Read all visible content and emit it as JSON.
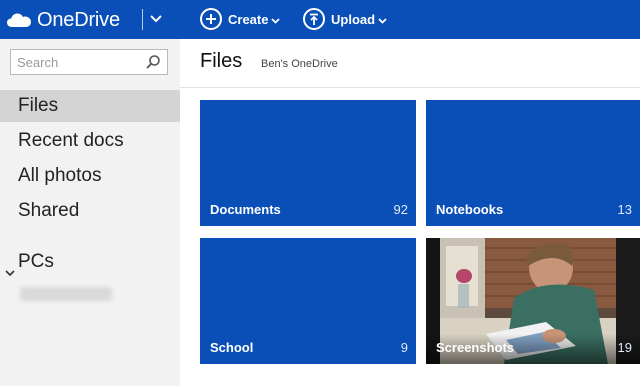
{
  "app": {
    "name": "OneDrive"
  },
  "toolbar": {
    "create_label": "Create",
    "upload_label": "Upload"
  },
  "search": {
    "placeholder": "Search",
    "value": ""
  },
  "sidebar": {
    "items": [
      {
        "label": "Files",
        "active": true
      },
      {
        "label": "Recent docs",
        "active": false
      },
      {
        "label": "All photos",
        "active": false
      },
      {
        "label": "Shared",
        "active": false
      }
    ],
    "pcs_label": "PCs"
  },
  "main": {
    "title": "Files",
    "breadcrumb": "Ben's OneDrive"
  },
  "tiles": [
    {
      "name": "Documents",
      "count": "92"
    },
    {
      "name": "Notebooks",
      "count": "13"
    },
    {
      "name": "School",
      "count": "9"
    },
    {
      "name": "Screenshots",
      "count": "19"
    }
  ],
  "colors": {
    "accent": "#0a4fb8",
    "sidebar_bg": "#f2f2f2",
    "active_item": "#d4d4d4"
  }
}
